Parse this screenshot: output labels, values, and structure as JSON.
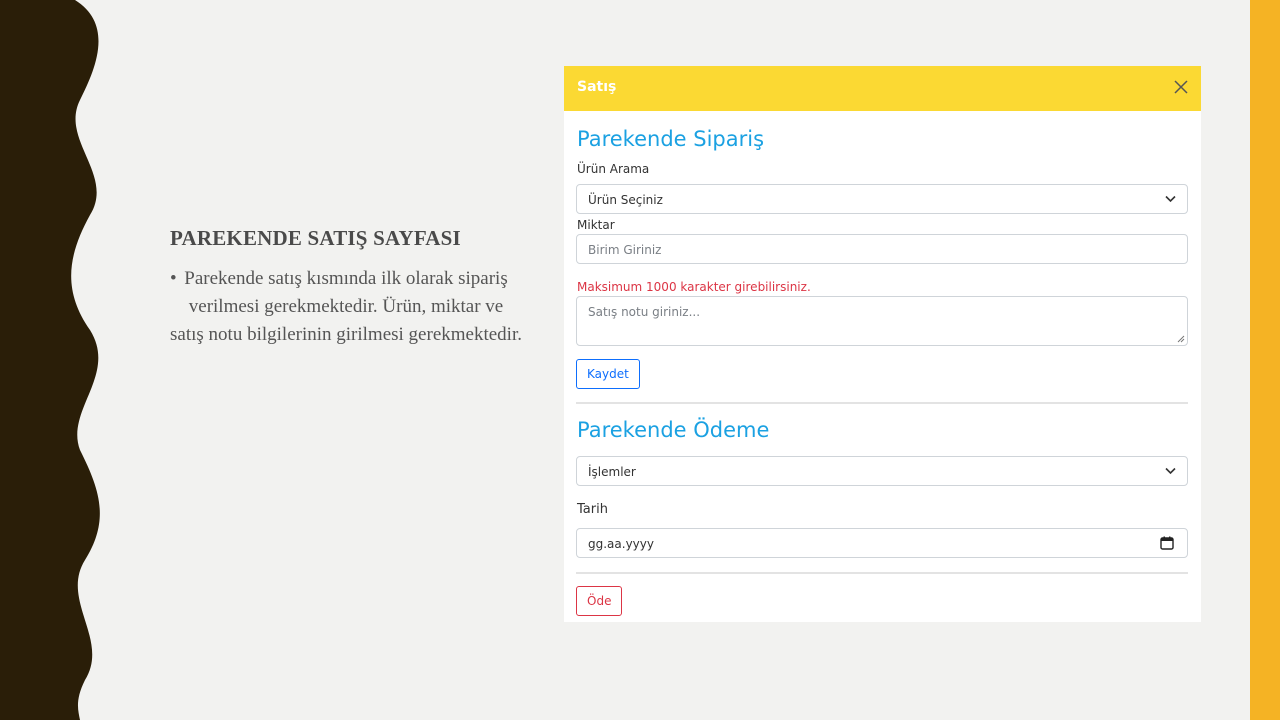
{
  "slide": {
    "title": "PAREKENDE SATIŞ SAYFASI",
    "bullet": "•",
    "body": "Parekende satış kısmında ilk olarak sipariş verilmesi gerekmektedir. Ürün, miktar ve satış notu bilgilerinin girilmesi gerekmektedir."
  },
  "modal": {
    "title": "Satış",
    "order": {
      "heading": "Parekende Sipariş",
      "product_label": "Ürün Arama",
      "product_selected": "Ürün Seçiniz",
      "quantity_label": "Miktar",
      "quantity_placeholder": "Birim Giriniz",
      "note_warning": "Maksimum 1000 karakter girebilirsiniz.",
      "note_placeholder": "Satış notu giriniz...",
      "save_label": "Kaydet"
    },
    "payment": {
      "heading": "Parekende Ödeme",
      "operations_selected": "İşlemler",
      "date_label": "Tarih",
      "date_placeholder": "gg.aa.yyyy",
      "pay_label": "Öde"
    }
  },
  "colors": {
    "header": "#fbd933",
    "heading": "#1ba1e2",
    "accent_bar": "#f5b324",
    "wave": "#2a1e08"
  },
  "icons": [
    "close-icon",
    "chevron-down-icon",
    "calendar-icon",
    "resize-handle-icon"
  ]
}
